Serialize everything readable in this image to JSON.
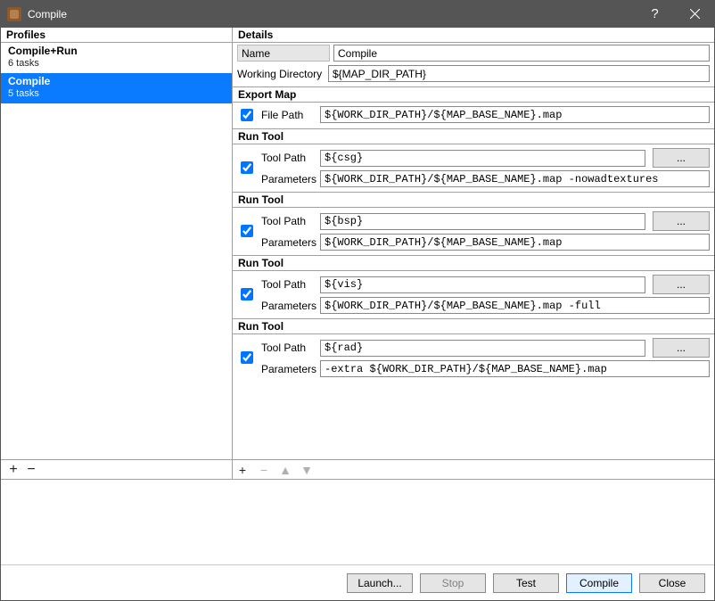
{
  "window": {
    "title": "Compile"
  },
  "profiles_header": "Profiles",
  "details_header": "Details",
  "profiles": [
    {
      "name": "Compile+Run",
      "tasks": "6 tasks",
      "selected": false
    },
    {
      "name": "Compile",
      "tasks": "5 tasks",
      "selected": true
    }
  ],
  "details": {
    "name_label": "Name",
    "name_value": "Compile",
    "workdir_label": "Working Directory",
    "workdir_value": "${MAP_DIR_PATH}"
  },
  "groups": [
    {
      "title": "Export Map",
      "checked": true,
      "rows": [
        {
          "label": "File Path",
          "value": "${WORK_DIR_PATH}/${MAP_BASE_NAME}.map",
          "browse": false
        }
      ]
    },
    {
      "title": "Run Tool",
      "checked": true,
      "rows": [
        {
          "label": "Tool Path",
          "value": "${csg}",
          "browse": true
        },
        {
          "label": "Parameters",
          "value": "${WORK_DIR_PATH}/${MAP_BASE_NAME}.map -nowadtextures",
          "browse": false
        }
      ]
    },
    {
      "title": "Run Tool",
      "checked": true,
      "rows": [
        {
          "label": "Tool Path",
          "value": "${bsp}",
          "browse": true
        },
        {
          "label": "Parameters",
          "value": "${WORK_DIR_PATH}/${MAP_BASE_NAME}.map",
          "browse": false
        }
      ]
    },
    {
      "title": "Run Tool",
      "checked": true,
      "rows": [
        {
          "label": "Tool Path",
          "value": "${vis}",
          "browse": true
        },
        {
          "label": "Parameters",
          "value": "${WORK_DIR_PATH}/${MAP_BASE_NAME}.map -full",
          "browse": false
        }
      ]
    },
    {
      "title": "Run Tool",
      "checked": true,
      "rows": [
        {
          "label": "Tool Path",
          "value": "${rad}",
          "browse": true
        },
        {
          "label": "Parameters",
          "value": "-extra ${WORK_DIR_PATH}/${MAP_BASE_NAME}.map",
          "browse": false
        }
      ]
    }
  ],
  "browse_label": "...",
  "buttons": {
    "launch": "Launch...",
    "stop": "Stop",
    "test": "Test",
    "compile": "Compile",
    "close": "Close"
  },
  "toolbar": {
    "plus": "+",
    "minus": "−",
    "up": "▲",
    "down": "▼"
  }
}
